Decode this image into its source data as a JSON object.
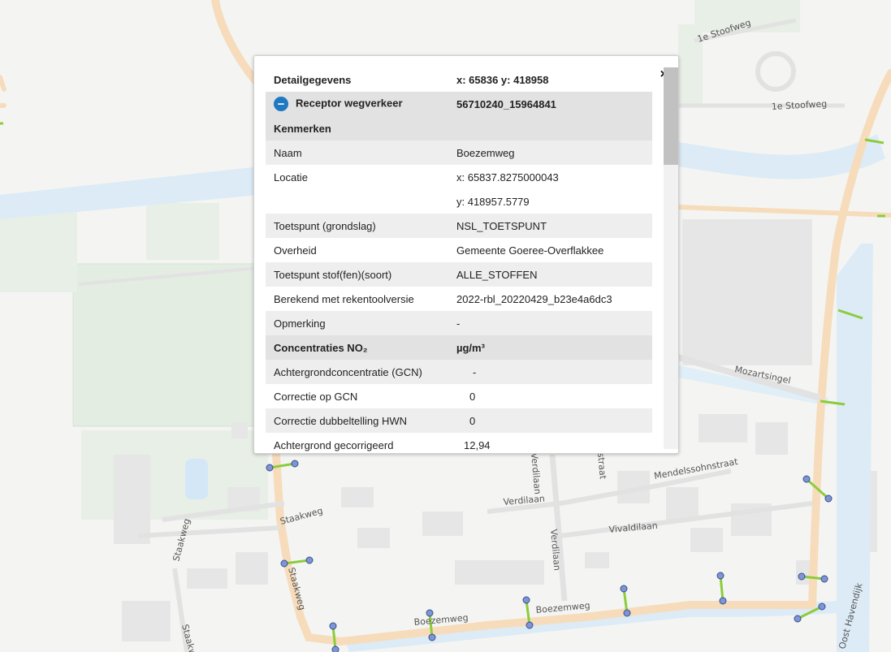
{
  "map": {
    "street_labels": [
      "1e Stoofweg",
      "1e Stoofweg",
      "Mozartsingel",
      "Mendelssohnstraat",
      "Verdilaan",
      "Verdilaan",
      "Vivaldilaan",
      "Staakweg",
      "Staakweg",
      "Staakweg",
      "Staakweg",
      "Boezemweg",
      "Boezemweg",
      "Verdilaan",
      "straat",
      "Oost Havendijk"
    ],
    "colors": {
      "road": "#f7dcbc",
      "water": "#dcebf6",
      "green": "#e3ede2",
      "receptor_point": "#7d95d6",
      "receptor_line": "#8ccc3c"
    }
  },
  "popup": {
    "title": "Detailgegevens",
    "coords": "x: 65836 y: 418958",
    "close_label": "×",
    "receptor_label": "Receptor wegverkeer",
    "receptor_id": "56710240_15964841",
    "collapse_icon": "−",
    "section_kenmerken": "Kenmerken",
    "rows": [
      {
        "label": "Naam",
        "value": "Boezemweg"
      },
      {
        "label": "Locatie",
        "value": "x: 65837.8275000043"
      },
      {
        "label": "",
        "value": "y: 418957.5779"
      },
      {
        "label": "Toetspunt (grondslag)",
        "value": "NSL_TOETSPUNT"
      },
      {
        "label": "Overheid",
        "value": "Gemeente Goeree-Overflakkee"
      },
      {
        "label": "Toetspunt stof(fen)(soort)",
        "value": "ALLE_STOFFEN"
      },
      {
        "label": "Berekend met rekentoolversie",
        "value": "2022-rbl_20220429_b23e4a6dc3"
      },
      {
        "label": "Opmerking",
        "value": "-"
      }
    ],
    "section_conc": "Concentraties NO₂",
    "section_conc_unit": "µg/m³",
    "conc_rows": [
      {
        "label": "Achtergrondconcentratie (GCN)",
        "value": "-"
      },
      {
        "label": "Correctie op GCN",
        "value": "0"
      },
      {
        "label": "Correctie dubbeltelling HWN",
        "value": "0"
      },
      {
        "label": "Achtergrond gecorrigeerd",
        "value": "12,94"
      }
    ]
  }
}
